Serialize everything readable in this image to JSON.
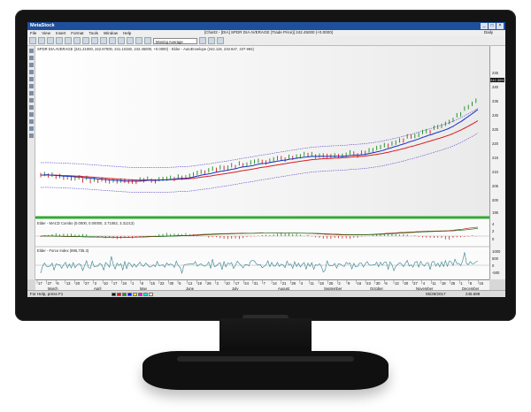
{
  "app": {
    "name": "MetaStock",
    "chart_title": "[Chart2 - [DIA] SPDR DIA AVERAGE (Trade Price)] 242.45000 (+0.0000)",
    "period": "Daily"
  },
  "menu": [
    "File",
    "View",
    "Insert",
    "Format",
    "Tools",
    "Window",
    "Help"
  ],
  "toolbar": {
    "indicator_select": "Moving Average"
  },
  "price_pane": {
    "legend": "SPDR DIA AVERAGE (241.21000, 242.87000, 241.10150, 242.45000, +0.0000) - Elder - AutoEnvelope (242.118, 233.647, 237.993)",
    "y_ticks": [
      "245",
      "240",
      "235",
      "230",
      "225",
      "220",
      "215",
      "210",
      "205",
      "200",
      "195"
    ],
    "last_price": "242.3000"
  },
  "macd_pane": {
    "legend": "Elder - MACD Combo (0.0000, 0.00000, 3.71082, 3.31213)",
    "y_ticks": [
      "4",
      "2",
      "0"
    ]
  },
  "force_pane": {
    "legend": "Elder - Force Index (895,735.3)",
    "y_ticks": [
      "1000",
      "500",
      "0",
      "-500"
    ]
  },
  "dates": {
    "days": [
      "17",
      "27",
      "6",
      "13",
      "20",
      "27",
      "3",
      "10",
      "17",
      "24",
      "1",
      "8",
      "15",
      "22",
      "30",
      "5",
      "12",
      "19",
      "26",
      "3",
      "10",
      "17",
      "24",
      "31",
      "7",
      "14",
      "21",
      "28",
      "4",
      "11",
      "18",
      "25",
      "2",
      "9",
      "16",
      "23",
      "30",
      "6",
      "13",
      "20",
      "27",
      "4",
      "11",
      "18",
      "25",
      "1",
      "8",
      "15"
    ],
    "months": [
      "March",
      "April",
      "May",
      "June",
      "July",
      "August",
      "September",
      "October",
      "November",
      "December"
    ]
  },
  "status": {
    "help": "For Help, press F1",
    "date": "06/29/2017",
    "value": "245.699"
  },
  "colors": {
    "titlebar": "#1e4f9c",
    "up_bar": "#1a8a1a",
    "down_bar": "#d81c1c",
    "ema_fast": "#1530c8",
    "ema_slow": "#d81c1c",
    "envelope": "#6a5acd"
  }
}
